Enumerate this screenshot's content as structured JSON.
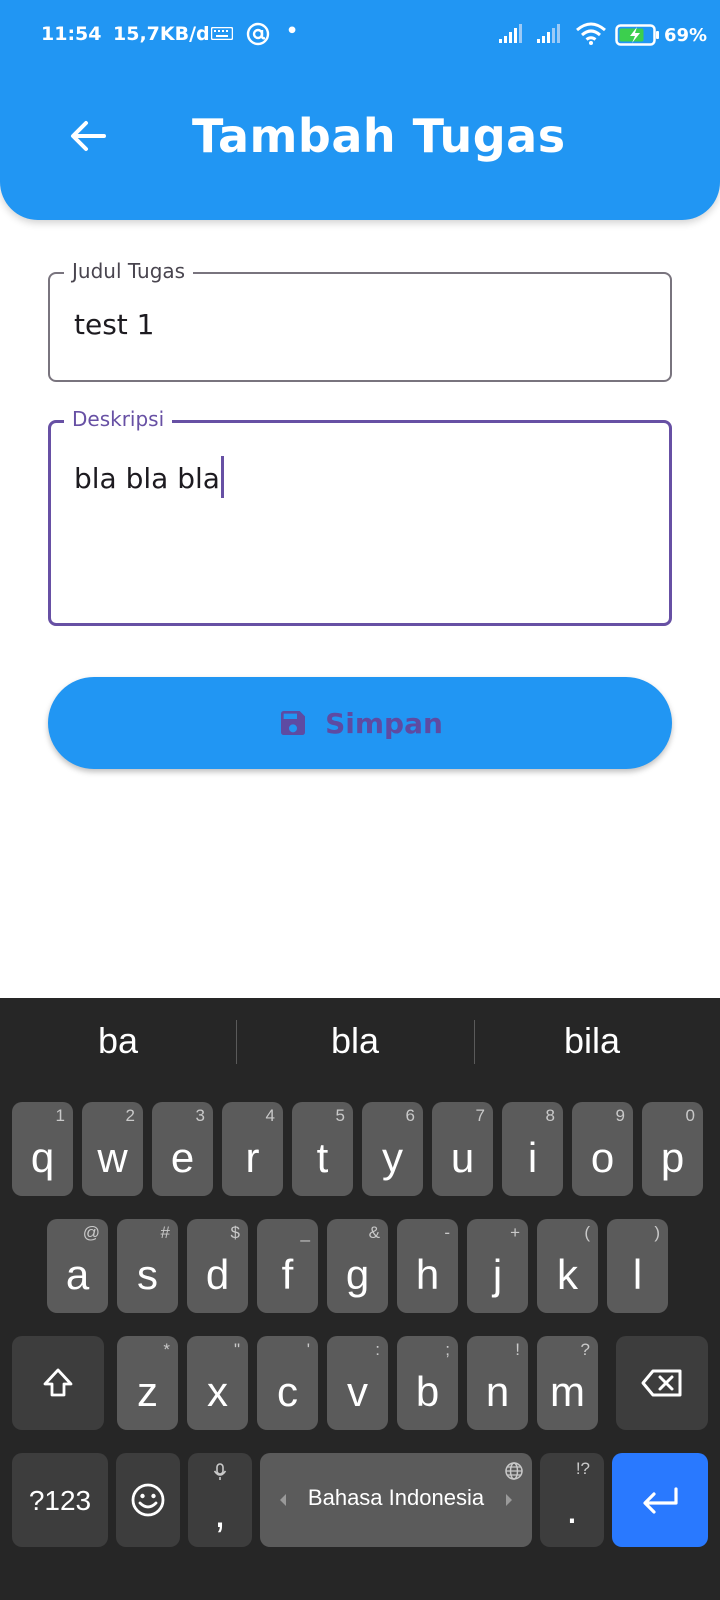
{
  "status_bar": {
    "time": "11:54",
    "network_speed": "15,7KB/d",
    "dot": "•",
    "battery_percent": "69%",
    "icons": [
      "keyboard-icon",
      "at-sign-icon",
      "signal-icon",
      "signal-icon",
      "wifi-icon",
      "battery-charging-icon"
    ]
  },
  "app_bar": {
    "title": "Tambah Tugas",
    "back_icon": "arrow-left-icon",
    "color": "#2196F3"
  },
  "form": {
    "title_field": {
      "label": "Judul Tugas",
      "value": "test 1"
    },
    "description_field": {
      "label": "Deskripsi",
      "value": "bla bla bla",
      "focused": true,
      "focus_color": "#6750A4"
    },
    "save_button": {
      "label": "Simpan",
      "icon": "save-icon"
    }
  },
  "keyboard": {
    "suggestions": [
      "ba",
      "bla",
      "bila"
    ],
    "row1": [
      {
        "k": "q",
        "h": "1"
      },
      {
        "k": "w",
        "h": "2"
      },
      {
        "k": "e",
        "h": "3"
      },
      {
        "k": "r",
        "h": "4"
      },
      {
        "k": "t",
        "h": "5"
      },
      {
        "k": "y",
        "h": "6"
      },
      {
        "k": "u",
        "h": "7"
      },
      {
        "k": "i",
        "h": "8"
      },
      {
        "k": "o",
        "h": "9"
      },
      {
        "k": "p",
        "h": "0"
      }
    ],
    "row2": [
      {
        "k": "a",
        "h": "@"
      },
      {
        "k": "s",
        "h": "#"
      },
      {
        "k": "d",
        "h": "$"
      },
      {
        "k": "f",
        "h": "_"
      },
      {
        "k": "g",
        "h": "&"
      },
      {
        "k": "h",
        "h": "-"
      },
      {
        "k": "j",
        "h": "+"
      },
      {
        "k": "k",
        "h": "("
      },
      {
        "k": "l",
        "h": ")"
      }
    ],
    "row3": [
      {
        "k": "z",
        "h": "*"
      },
      {
        "k": "x",
        "h": "\""
      },
      {
        "k": "c",
        "h": "'"
      },
      {
        "k": "v",
        "h": ":"
      },
      {
        "k": "b",
        "h": ";"
      },
      {
        "k": "n",
        "h": "!"
      },
      {
        "k": "m",
        "h": "?"
      }
    ],
    "symbols_key": "?123",
    "comma_key": ",",
    "space_label": "Bahasa Indonesia",
    "period_key": ".",
    "period_hint": "!?",
    "shift_icon": "shift-icon",
    "backspace_icon": "backspace-icon",
    "emoji_icon": "emoji-icon",
    "mic_icon": "mic-icon",
    "globe_icon": "globe-icon",
    "enter_icon": "enter-icon",
    "enter_color": "#2979FF"
  }
}
